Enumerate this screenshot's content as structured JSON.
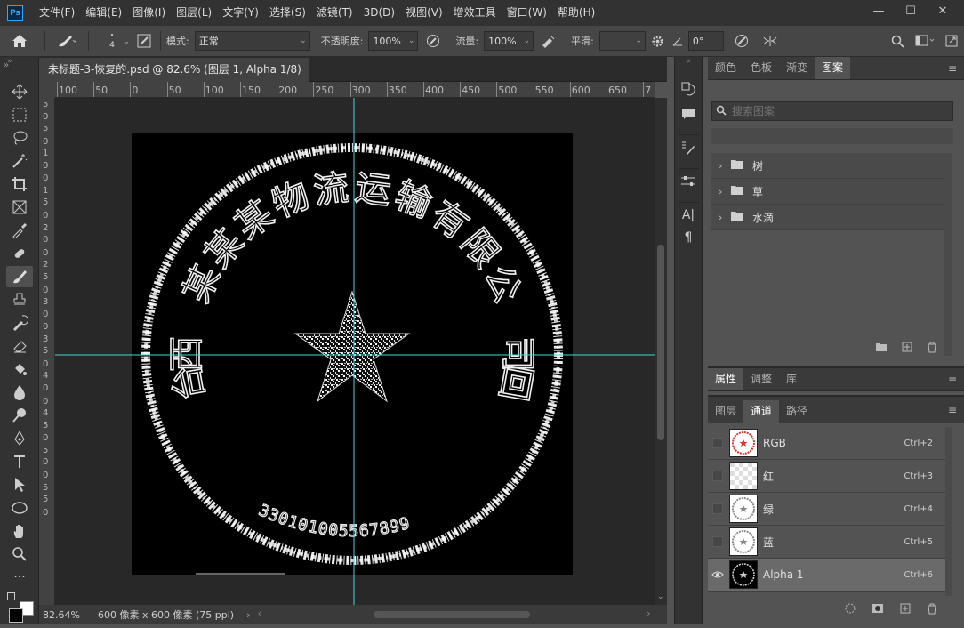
{
  "app": {
    "logo": "Ps"
  },
  "menubar": {
    "items": [
      "文件(F)",
      "编辑(E)",
      "图像(I)",
      "图层(L)",
      "文字(Y)",
      "选择(S)",
      "滤镜(T)",
      "3D(D)",
      "视图(V)",
      "增效工具",
      "窗口(W)",
      "帮助(H)"
    ]
  },
  "window": {
    "min": "—",
    "max": "☐",
    "close": "✕"
  },
  "options": {
    "brush_size": "4",
    "mode_label": "模式:",
    "mode_value": "正常",
    "opacity_label": "不透明度:",
    "opacity_value": "100%",
    "flow_label": "流量:",
    "flow_value": "100%",
    "smooth_label": "平滑:",
    "smooth_value": "",
    "angle_value": "0°"
  },
  "document": {
    "tab_title": "未标题-3-恢复的.psd @ 82.6% (图层 1, Alpha 1/8) *",
    "close": "×"
  },
  "ruler": {
    "h_labels": [
      "100",
      "50",
      "0",
      "50",
      "100",
      "150",
      "200",
      "250",
      "300",
      "350",
      "400",
      "450",
      "500",
      "550",
      "600",
      "650",
      "7"
    ],
    "v_labels": [
      "5",
      "0",
      "5",
      "0",
      "1",
      "0",
      "0",
      "1",
      "5",
      "0",
      "2",
      "0",
      "0",
      "2",
      "5",
      "0",
      "3",
      "0",
      "0",
      "3",
      "5",
      "0",
      "4",
      "0",
      "0",
      "4",
      "5",
      "0",
      "5",
      "0",
      "0",
      "5",
      "5",
      "0"
    ]
  },
  "stamp": {
    "arc_text": "某某某物流运输有限公司",
    "arc_chars": [
      "台",
      "西",
      "某",
      "某",
      "某",
      "物",
      "流",
      "运",
      "输",
      "有",
      "限",
      "公",
      "司",
      "回"
    ],
    "number": "330101005567899"
  },
  "status": {
    "zoom": "82.64%",
    "info": "600 像素 x 600 像素 (75 ppi)",
    "arrow": "›"
  },
  "pattern_panel": {
    "tabs": [
      "颜色",
      "色板",
      "渐变",
      "图案"
    ],
    "active_tab": "图案",
    "search_placeholder": "搜索图案",
    "folders": [
      "树",
      "草",
      "水滴"
    ]
  },
  "props_panel": {
    "tabs": [
      "属性",
      "调整",
      "库"
    ],
    "active_tab": "属性"
  },
  "channels_panel": {
    "tabs": [
      "图层",
      "通道",
      "路径"
    ],
    "active_tab": "通道",
    "channels": [
      {
        "name": "RGB",
        "shortcut": "Ctrl+2"
      },
      {
        "name": "红",
        "shortcut": "Ctrl+3"
      },
      {
        "name": "绿",
        "shortcut": "Ctrl+4"
      },
      {
        "name": "蓝",
        "shortcut": "Ctrl+5"
      },
      {
        "name": "Alpha 1",
        "shortcut": "Ctrl+6"
      }
    ]
  },
  "colors": {
    "guide": "#45d6e0",
    "accent": "#31a8ff",
    "stamp_red": "#e03030"
  }
}
